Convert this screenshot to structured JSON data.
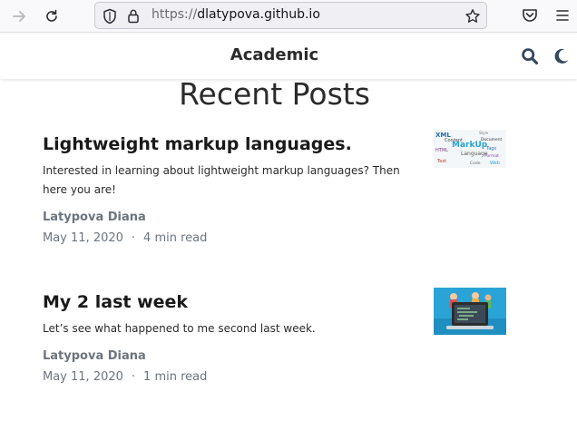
{
  "browser": {
    "url_protocol": "https://",
    "url_host": "dlatypova.github.io"
  },
  "site": {
    "brand": "Academic"
  },
  "section": {
    "title": "Recent Posts"
  },
  "posts": [
    {
      "title": "Lightweight markup languages.",
      "summary": "Interested in learning about lightweight markup languages? Then here you are!",
      "author": "Latypova Diana",
      "date": "May 11, 2020",
      "separator": "·",
      "read_time": "4 min read",
      "thumb": {
        "words": [
          "XML",
          "MarkUp",
          "Content",
          "Language",
          "HTML",
          "Text",
          "Document",
          "Tags",
          "Web",
          "Code",
          "Format",
          "Style"
        ]
      }
    },
    {
      "title": "My 2 last week",
      "summary": "Let’s see what happened to me second last week.",
      "author": "Latypova Diana",
      "date": "May 11, 2020",
      "separator": "·",
      "read_time": "1 min read"
    }
  ],
  "colors": {
    "accent": "#1a1a1a",
    "meta": "#6c757d",
    "thumb_sky": "#2aa3d6"
  }
}
